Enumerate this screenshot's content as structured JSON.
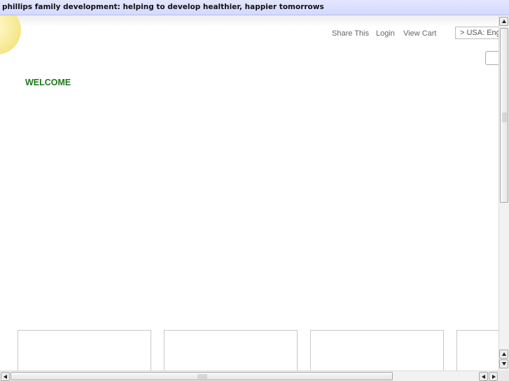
{
  "window": {
    "title": "phillips family development: helping to develop healthier, happier tomorrows"
  },
  "header": {
    "nav": {
      "share_label": "Share This",
      "login_label": "Login",
      "cart_label": "View Cart"
    },
    "region_select": {
      "selected": "> USA: English"
    },
    "search": {
      "value": ""
    }
  },
  "main": {
    "welcome_heading": "WELCOME"
  },
  "colors": {
    "accent_green": "#1a7a1a",
    "titlebar": "#d4d9ff",
    "logo_yellow": "#f5e68a"
  },
  "icons": {
    "logo": "sun-logo-icon",
    "scroll_up": "arrow-up-icon",
    "scroll_down": "arrow-down-icon",
    "scroll_left": "arrow-left-icon",
    "scroll_right": "arrow-right-icon"
  }
}
